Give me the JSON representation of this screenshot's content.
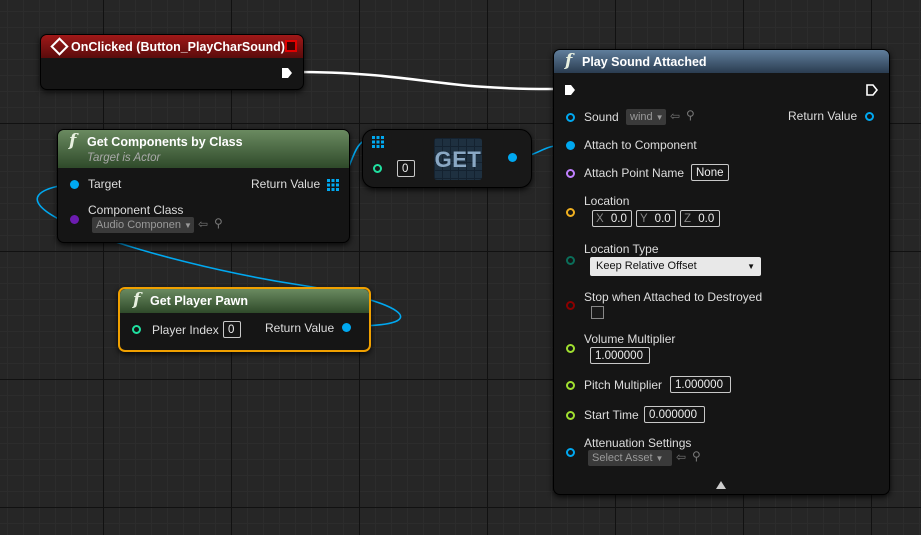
{
  "nodes": {
    "onclicked": {
      "title": "OnClicked (Button_PlayCharSound)"
    },
    "get_components": {
      "title": "Get Components by Class",
      "subtitle": "Target is Actor",
      "pins": {
        "target": "Target",
        "return_value": "Return Value",
        "component_class": "Component Class"
      },
      "component_class_value": "Audio Componen"
    },
    "get_array": {
      "label": "GET",
      "index_value": "0"
    },
    "get_player_pawn": {
      "title": "Get Player Pawn",
      "pins": {
        "player_index": "Player Index",
        "return_value": "Return Value"
      },
      "player_index_value": "0"
    },
    "play_sound_attached": {
      "title": "Play Sound Attached",
      "pins": {
        "sound": "Sound",
        "return_value": "Return Value",
        "attach_to_component": "Attach to Component",
        "attach_point_name": "Attach Point Name",
        "location": "Location",
        "location_type": "Location Type",
        "stop_when_attached": "Stop when Attached to Destroyed",
        "volume_multiplier": "Volume Multiplier",
        "pitch_multiplier": "Pitch Multiplier",
        "start_time": "Start Time",
        "attenuation_settings": "Attenuation Settings"
      },
      "values": {
        "sound": "wind",
        "attach_point_name": "None",
        "loc_x_label": "X",
        "loc_x": "0.0",
        "loc_y_label": "Y",
        "loc_y": "0.0",
        "loc_z_label": "Z",
        "loc_z": "0.0",
        "location_type": "Keep Relative Offset",
        "volume_multiplier": "1.000000",
        "pitch_multiplier": "1.000000",
        "start_time": "0.000000",
        "attenuation_settings": "Select Asset"
      }
    }
  },
  "colors": {
    "exec": "#ffffff",
    "object_pin": "#00a8f0",
    "class_pin": "#6c1cb0",
    "name_pin": "#c080ff",
    "vector_pin": "#f0b020",
    "enum_pin": "#0a6e5a",
    "bool_pin": "#8c0000",
    "float_pin": "#a0e030",
    "int_pin": "#20e0a0",
    "event_header": "#8a1010",
    "function_header": "#6a8a60",
    "selection": "#f0a000"
  },
  "icons": [
    "event-diamond-icon",
    "function-f-icon",
    "array-grid-icon",
    "dropdown-arrow-icon",
    "magnifier-icon",
    "back-arrow-icon",
    "expand-triangle-icon"
  ]
}
